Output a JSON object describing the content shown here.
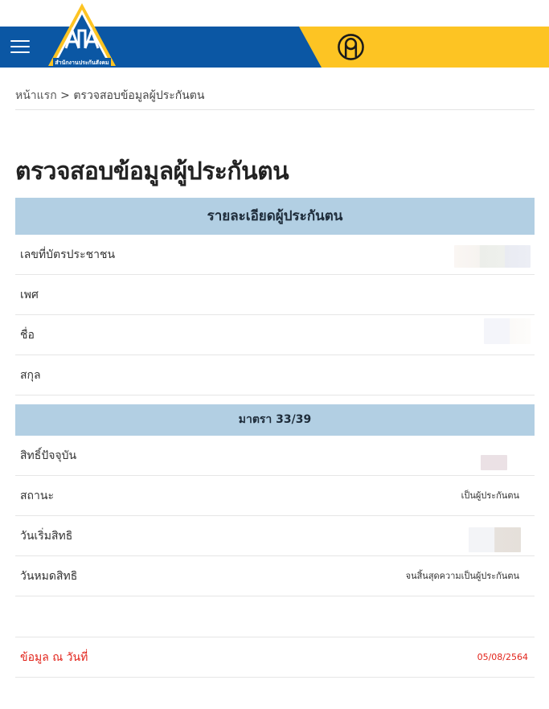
{
  "header": {
    "logo_text": "สำนักงานประกันสังคม",
    "colors": {
      "blue": "#0b57a4",
      "yellow": "#fdc423"
    },
    "menu_icon": "hamburger-icon",
    "user_icon": "user-circle-icon"
  },
  "breadcrumb": {
    "home": "หน้าแรก",
    "separator": " > ",
    "current": "ตรวจสอบข้อมูลผู้ประกันตน"
  },
  "page_title": "ตรวจสอบข้อมูลผู้ประกันตน",
  "insured_section": {
    "title": "รายละเอียดผู้ประกันตน",
    "rows": [
      {
        "label": "เลขที่บัตรประชาชน",
        "value": ""
      },
      {
        "label": "เพศ",
        "value": ""
      },
      {
        "label": "ชื่อ",
        "value": ""
      },
      {
        "label": "สกุล",
        "value": ""
      }
    ]
  },
  "article_section": {
    "title": "มาตรา 33/39",
    "rows": [
      {
        "label": "สิทธิ์ปัจจุบัน",
        "value": ""
      },
      {
        "label": "สถานะ",
        "value": "เป็นผู้ประกันตน"
      },
      {
        "label": "วันเริ่มสิทธิ",
        "value": ""
      },
      {
        "label": "วันหมดสิทธิ",
        "value": "จนสิ้นสุดความเป็นผู้ประกันตน"
      }
    ]
  },
  "footer": {
    "label": "ข้อมูล ณ วันที่",
    "date": "05/08/2564",
    "color": "#e2231a"
  }
}
